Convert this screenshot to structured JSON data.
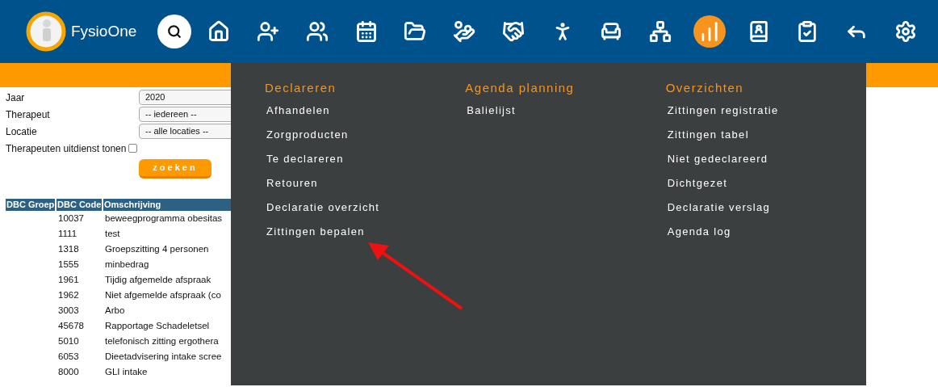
{
  "brand": {
    "name": "FysioOne"
  },
  "nav_buttons": [
    {
      "selected": false
    },
    {
      "selected": false
    },
    {
      "selected": false
    },
    {
      "selected": false
    },
    {
      "selected": false
    },
    {
      "selected": false
    },
    {
      "selected": false
    },
    {
      "selected": false
    },
    {
      "selected": false
    },
    {
      "selected": false
    },
    {
      "selected": true
    },
    {
      "selected": false
    },
    {
      "selected": false
    },
    {
      "selected": false
    },
    {
      "selected": false
    }
  ],
  "filters": [
    {
      "kind": "select",
      "label": "Jaar",
      "value": "2020"
    },
    {
      "kind": "select",
      "label": "Therapeut",
      "value": "-- iedereen --"
    },
    {
      "kind": "select",
      "label": "Locatie",
      "value": "-- alle locaties --"
    },
    {
      "kind": "checkbox",
      "label": "Therapeuten uitdienst tonen",
      "checked": false
    }
  ],
  "search_button": "zoeken",
  "table": {
    "columns": [
      "DBC Groep",
      "DBC Code",
      "Omschrijving"
    ],
    "rows": [
      [
        "",
        "10037",
        "beweegprogramma obesitas"
      ],
      [
        "",
        "1111",
        "test"
      ],
      [
        "",
        "1318",
        "Groepszitting 4 personen"
      ],
      [
        "",
        "1555",
        "minbedrag"
      ],
      [
        "",
        "1961",
        "Tijdig afgemelde afspraak"
      ],
      [
        "",
        "1962",
        "Niet afgemelde afspraak (co"
      ],
      [
        "",
        "3003",
        "Arbo"
      ],
      [
        "",
        "45678",
        "Rapportage Schadeletsel"
      ],
      [
        "",
        "5010",
        "telefonisch zitting ergothera"
      ],
      [
        "",
        "6053",
        "Dieetadvisering intake scree"
      ],
      [
        "",
        "8000",
        "GLI intake"
      ]
    ]
  },
  "menu": {
    "sections": [
      {
        "title": "Declareren",
        "items": [
          "Afhandelen",
          "Zorgproducten",
          "Te declareren",
          "Retouren",
          "Declaratie overzicht",
          "Zittingen bepalen"
        ]
      },
      {
        "title": "Agenda planning",
        "items": [
          "Balielijst"
        ]
      },
      {
        "title": "Overzichten",
        "items": [
          "Zittingen registratie",
          "Zittingen tabel",
          "Niet gedeclareerd",
          "Dichtgezet",
          "Declaratie verslag",
          "Agenda log"
        ]
      }
    ]
  }
}
